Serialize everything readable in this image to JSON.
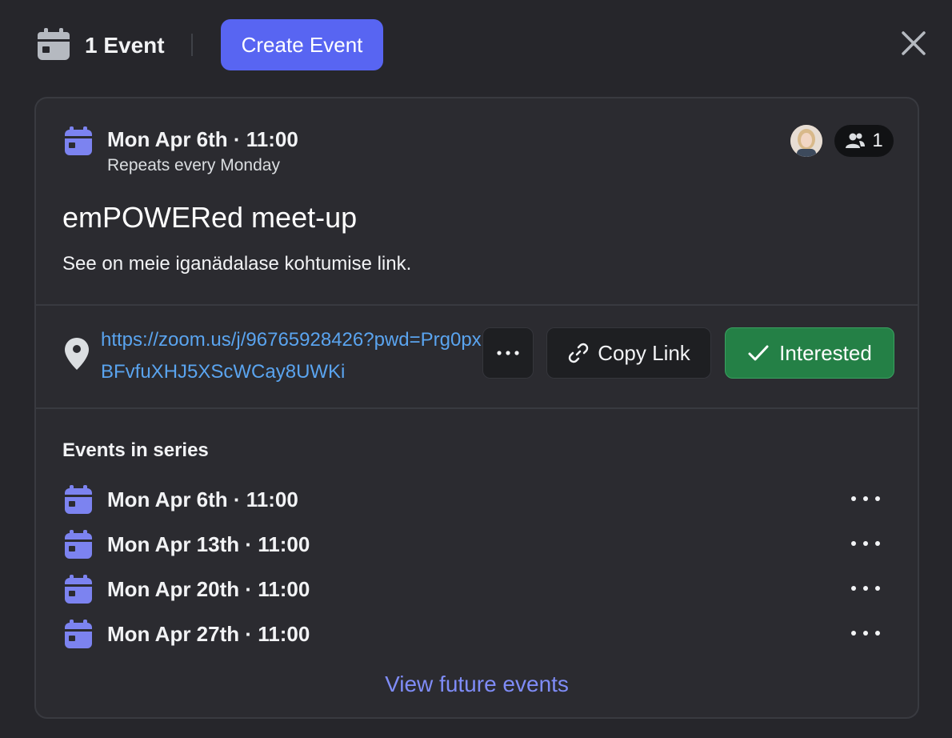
{
  "header": {
    "event_count_label": "1 Event",
    "create_button_label": "Create Event",
    "icons": {
      "calendar": "calendar-icon",
      "close": "close-icon"
    }
  },
  "event": {
    "date_time": "Mon Apr 6th · 11:00",
    "recurrence": "Repeats every Monday",
    "title": "emPOWERed meet-up",
    "description": "See on meie iganädalase kohtumise link.",
    "attendee_count": "1",
    "location_link": "https://zoom.us/j/96765928426?pwd=Prg0pxBFvfuXHJ5XScWCay8UWKi",
    "actions": {
      "copy_link_label": "Copy Link",
      "interested_label": "Interested"
    }
  },
  "series": {
    "heading": "Events in series",
    "items": [
      {
        "date_time": "Mon Apr 6th · 11:00"
      },
      {
        "date_time": "Mon Apr 13th · 11:00"
      },
      {
        "date_time": "Mon Apr 20th · 11:00"
      },
      {
        "date_time": "Mon Apr 27th · 11:00"
      }
    ],
    "view_more_label": "View future events"
  },
  "colors": {
    "background": "#26262b",
    "accent": "#5865f2",
    "calendar_icon": "#7c83f0",
    "link": "#5aa4ef",
    "interested_green": "#248046",
    "view_more": "#7f8cf7"
  }
}
